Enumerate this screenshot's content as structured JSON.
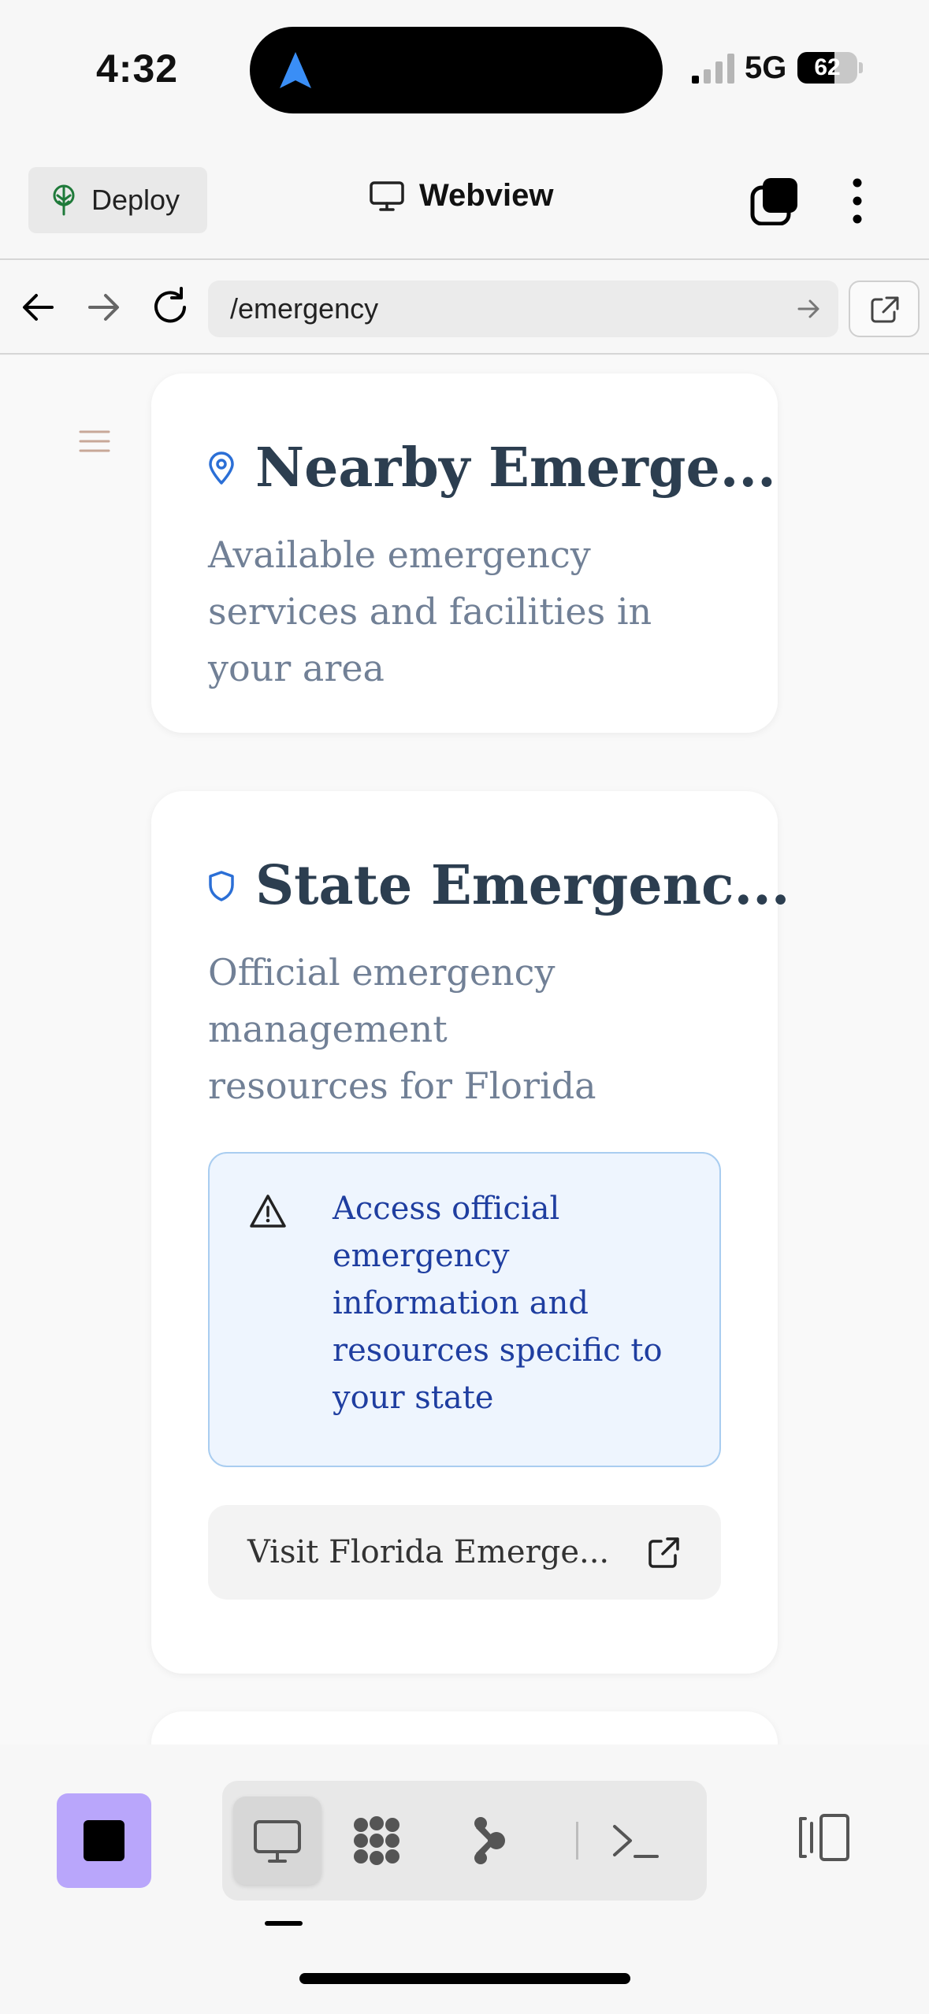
{
  "status_bar": {
    "time": "4:32",
    "network": "5G",
    "battery_percent": "62",
    "battery_level": 0.62
  },
  "header": {
    "deploy_label": "Deploy",
    "title": "Webview"
  },
  "browser": {
    "url": "/emergency"
  },
  "cards": {
    "nearby": {
      "title": "Nearby Emerge...",
      "subtitle": "Available emergency services and facilities in your area"
    },
    "state": {
      "title": "State Emergenc...",
      "subtitle": "Official emergency management resources for Florida",
      "alert_text": "Access official emergency information and resources specific to your state",
      "button_label": "Visit Florida Emerge..."
    }
  },
  "colors": {
    "accent_purple": "#b9a6fb",
    "title_color": "#2c3e50",
    "alert_bg": "#eef5fe",
    "alert_text": "#1f3ea0",
    "icon_blue": "#2b6fd6"
  },
  "bottom_bar": {
    "tools": [
      "webview-icon",
      "apps-icon",
      "agent-icon",
      "terminal-icon"
    ],
    "active_tool": "webview-icon"
  }
}
